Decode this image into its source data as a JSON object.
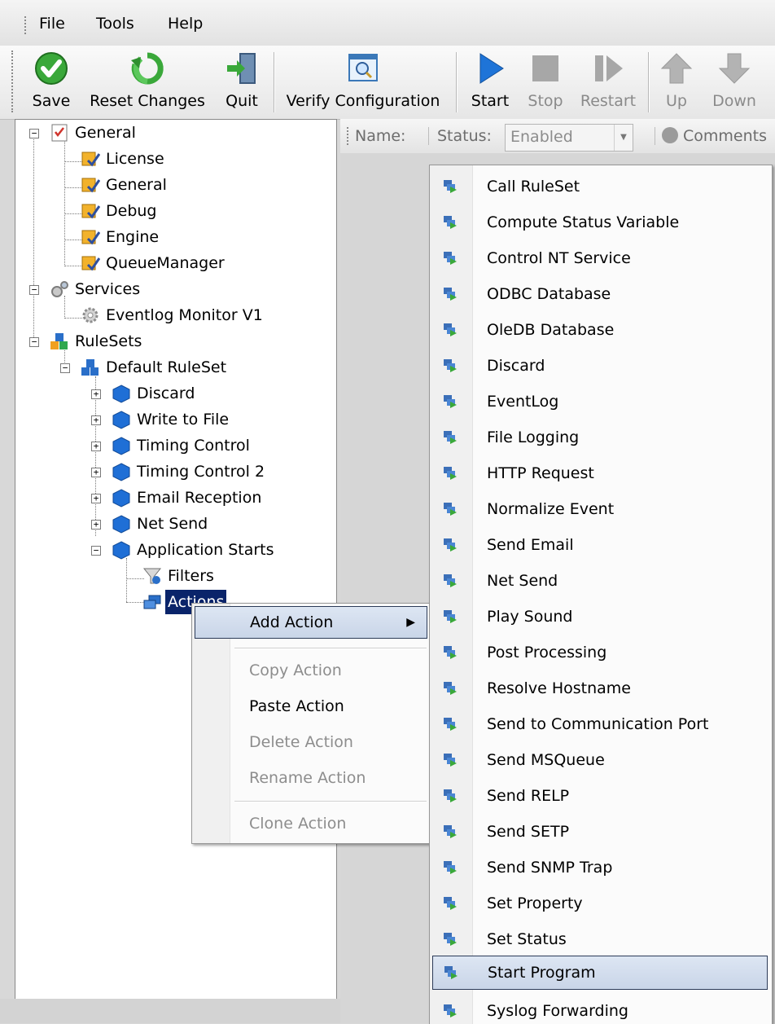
{
  "menubar": {
    "items": [
      "File",
      "Tools",
      "Help"
    ]
  },
  "toolbar": {
    "save": "Save",
    "reset": "Reset Changes",
    "quit": "Quit",
    "verify": "Verify Configuration",
    "start": "Start",
    "stop": "Stop",
    "restart": "Restart",
    "up": "Up",
    "down": "Down"
  },
  "propbar": {
    "name_label": "Name:",
    "status_label": "Status:",
    "status_value": "Enabled",
    "comments": "Comments"
  },
  "tree": {
    "general": "General",
    "license": "License",
    "general_child": "General",
    "debug": "Debug",
    "engine": "Engine",
    "queuemanager": "QueueManager",
    "services": "Services",
    "eventlog_monitor": "Eventlog Monitor V1",
    "rulesets": "RuleSets",
    "default_ruleset": "Default RuleSet",
    "rules": [
      "Discard",
      "Write to File",
      "Timing Control",
      "Timing Control 2",
      "Email Reception",
      "Net Send",
      "Application Starts"
    ],
    "filters": "Filters",
    "actions": "Actions"
  },
  "context_menu": {
    "add_action": "Add Action",
    "copy_action": "Copy Action",
    "paste_action": "Paste Action",
    "delete_action": "Delete Action",
    "rename_action": "Rename Action",
    "clone_action": "Clone Action"
  },
  "submenu": {
    "items": [
      "Call RuleSet",
      "Compute Status Variable",
      "Control NT Service",
      "ODBC Database",
      "OleDB Database",
      "Discard",
      "EventLog",
      "File Logging",
      "HTTP Request",
      "Normalize Event",
      "Send Email",
      "Net Send",
      "Play Sound",
      "Post Processing",
      "Resolve Hostname",
      "Send to Communication Port",
      "Send MSQueue",
      "Send RELP",
      "Send SETP",
      "Send SNMP Trap",
      "Set Property",
      "Set Status",
      "Start Program",
      "Syslog Forwarding"
    ],
    "highlighted": "Start Program"
  },
  "colors": {
    "selection": "#0a246a",
    "menu_highlight": "#c9d5e8",
    "menu_highlight_border": "#2c3b58"
  }
}
